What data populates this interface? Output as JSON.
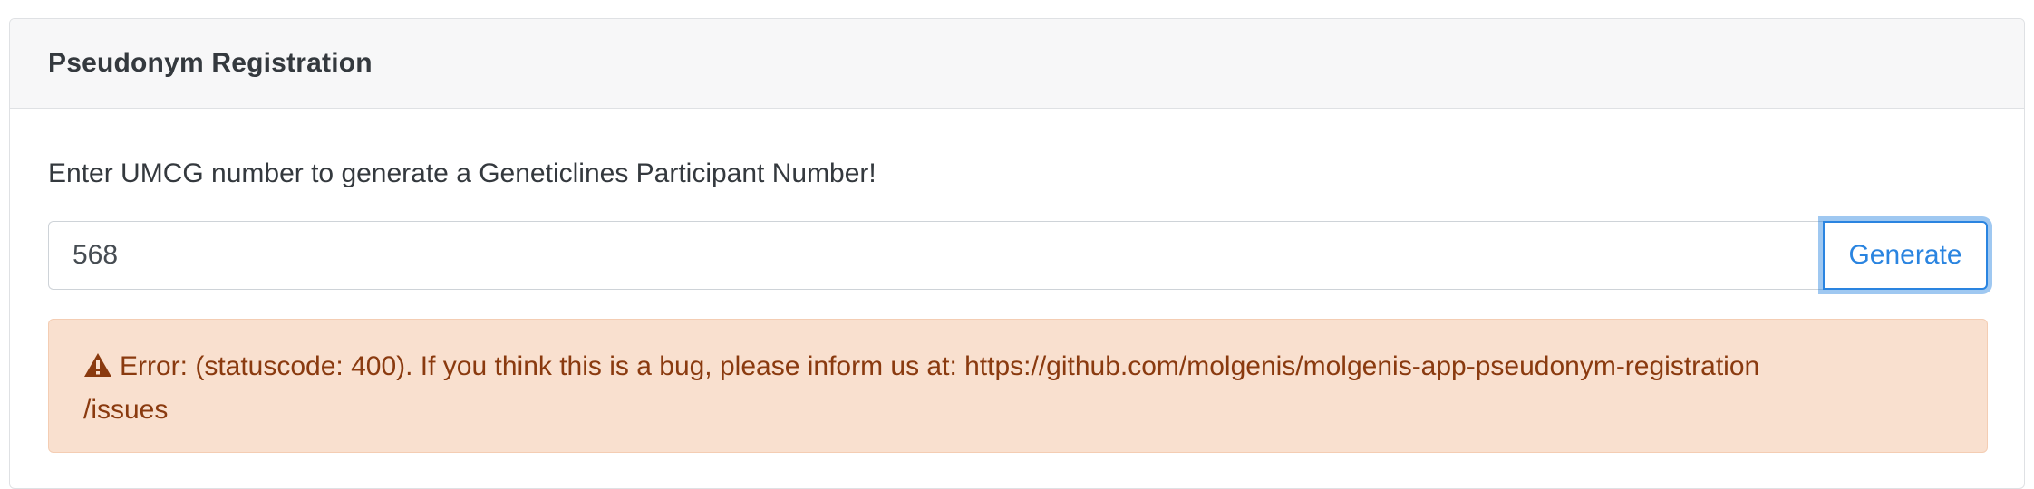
{
  "card": {
    "title": "Pseudonym Registration"
  },
  "form": {
    "instruction": "Enter UMCG number to generate a Geneticlines Participant Number!",
    "umcg_number_value": "568",
    "generate_label": "Generate"
  },
  "alert": {
    "icon": "warning-triangle-icon",
    "line1": "Error: (statuscode: 400). If you think this is a bug, please inform us at: https://github.com/molgenis/molgenis-app-pseudonym-registration",
    "line2": "/issues"
  },
  "colors": {
    "accent": "#2a84e0",
    "alert_background": "#f9e0cf",
    "alert_text": "#8a3a0f",
    "header_background": "#f7f7f8"
  }
}
